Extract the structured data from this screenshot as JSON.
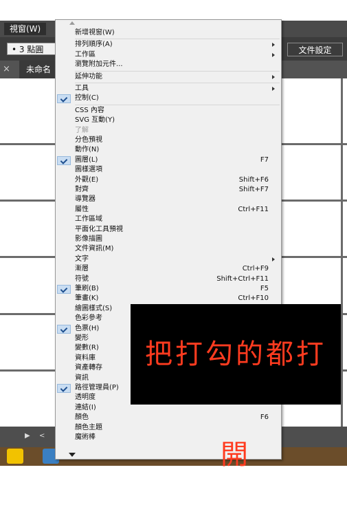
{
  "menubar": {
    "title": "視窗(W)"
  },
  "control_bar": {
    "stroke_select": "• 3 點圓",
    "doc_settings": "文件設定"
  },
  "tab": {
    "close": "×",
    "name": "未命名"
  },
  "status": {
    "prev": "▶",
    "next": "<"
  },
  "annotation": {
    "text": "把打勾的都打開",
    "text_color": "#ff3b1f"
  },
  "menu": {
    "items": [
      {
        "label": "新增視窗(W)",
        "shortcut": "",
        "checked": false,
        "submenu": false,
        "disabled": false
      },
      {
        "sep": true
      },
      {
        "label": "排列順序(A)",
        "shortcut": "",
        "checked": false,
        "submenu": true,
        "disabled": false
      },
      {
        "label": "工作區",
        "shortcut": "",
        "checked": false,
        "submenu": true,
        "disabled": false
      },
      {
        "label": "瀏覽附加元件...",
        "shortcut": "",
        "checked": false,
        "submenu": false,
        "disabled": false
      },
      {
        "sep": true
      },
      {
        "label": "延伸功能",
        "shortcut": "",
        "checked": false,
        "submenu": true,
        "disabled": false
      },
      {
        "sep": true
      },
      {
        "label": "工具",
        "shortcut": "",
        "checked": false,
        "submenu": true,
        "disabled": false
      },
      {
        "label": "控制(C)",
        "shortcut": "",
        "checked": true,
        "submenu": false,
        "disabled": false
      },
      {
        "sep": true
      },
      {
        "label": "CSS 內容",
        "shortcut": "",
        "checked": false,
        "submenu": false,
        "disabled": false
      },
      {
        "label": "SVG 互動(Y)",
        "shortcut": "",
        "checked": false,
        "submenu": false,
        "disabled": false
      },
      {
        "label": "了解",
        "shortcut": "",
        "checked": false,
        "submenu": false,
        "disabled": true
      },
      {
        "label": "分色預視",
        "shortcut": "",
        "checked": false,
        "submenu": false,
        "disabled": false
      },
      {
        "label": "動作(N)",
        "shortcut": "",
        "checked": false,
        "submenu": false,
        "disabled": false
      },
      {
        "label": "圖層(L)",
        "shortcut": "F7",
        "checked": true,
        "submenu": false,
        "disabled": false
      },
      {
        "label": "圖樣選項",
        "shortcut": "",
        "checked": false,
        "submenu": false,
        "disabled": false
      },
      {
        "label": "外觀(E)",
        "shortcut": "Shift+F6",
        "checked": false,
        "submenu": false,
        "disabled": false
      },
      {
        "label": "對齊",
        "shortcut": "Shift+F7",
        "checked": false,
        "submenu": false,
        "disabled": false
      },
      {
        "label": "導覽器",
        "shortcut": "",
        "checked": false,
        "submenu": false,
        "disabled": false
      },
      {
        "label": "屬性",
        "shortcut": "Ctrl+F11",
        "checked": false,
        "submenu": false,
        "disabled": false
      },
      {
        "label": "工作區域",
        "shortcut": "",
        "checked": false,
        "submenu": false,
        "disabled": false
      },
      {
        "label": "平面化工具預視",
        "shortcut": "",
        "checked": false,
        "submenu": false,
        "disabled": false
      },
      {
        "label": "影像描圖",
        "shortcut": "",
        "checked": false,
        "submenu": false,
        "disabled": false
      },
      {
        "label": "文件資訊(M)",
        "shortcut": "",
        "checked": false,
        "submenu": false,
        "disabled": false
      },
      {
        "label": "文字",
        "shortcut": "",
        "checked": false,
        "submenu": true,
        "disabled": false
      },
      {
        "label": "漸層",
        "shortcut": "Ctrl+F9",
        "checked": false,
        "submenu": false,
        "disabled": false
      },
      {
        "label": "符號",
        "shortcut": "Shift+Ctrl+F11",
        "checked": false,
        "submenu": false,
        "disabled": false
      },
      {
        "label": "筆刷(B)",
        "shortcut": "F5",
        "checked": true,
        "submenu": false,
        "disabled": false
      },
      {
        "label": "筆畫(K)",
        "shortcut": "Ctrl+F10",
        "checked": false,
        "submenu": false,
        "disabled": false
      },
      {
        "label": "繪圖樣式(S)",
        "shortcut": "",
        "checked": false,
        "submenu": false,
        "disabled": false
      },
      {
        "label": "色彩參考",
        "shortcut": "",
        "checked": false,
        "submenu": false,
        "disabled": false
      },
      {
        "label": "色票(H)",
        "shortcut": "",
        "checked": true,
        "submenu": false,
        "disabled": false
      },
      {
        "label": "變形",
        "shortcut": "",
        "checked": false,
        "submenu": false,
        "disabled": false
      },
      {
        "label": "變數(R)",
        "shortcut": "",
        "checked": false,
        "submenu": false,
        "disabled": false
      },
      {
        "label": "資料庫",
        "shortcut": "",
        "checked": false,
        "submenu": false,
        "disabled": false
      },
      {
        "label": "資產轉存",
        "shortcut": "",
        "checked": false,
        "submenu": false,
        "disabled": false
      },
      {
        "label": "資訊",
        "shortcut": "",
        "checked": false,
        "submenu": false,
        "disabled": false
      },
      {
        "label": "路徑管理員(P)",
        "shortcut": "",
        "checked": true,
        "submenu": false,
        "disabled": false
      },
      {
        "label": "透明度",
        "shortcut": "",
        "checked": false,
        "submenu": false,
        "disabled": false
      },
      {
        "label": "連結(I)",
        "shortcut": "",
        "checked": false,
        "submenu": false,
        "disabled": false
      },
      {
        "label": "顏色",
        "shortcut": "F6",
        "checked": false,
        "submenu": false,
        "disabled": false
      },
      {
        "label": "顏色主題",
        "shortcut": "",
        "checked": false,
        "submenu": false,
        "disabled": false
      },
      {
        "label": "魔術棒",
        "shortcut": "",
        "checked": false,
        "submenu": false,
        "disabled": false
      }
    ]
  }
}
